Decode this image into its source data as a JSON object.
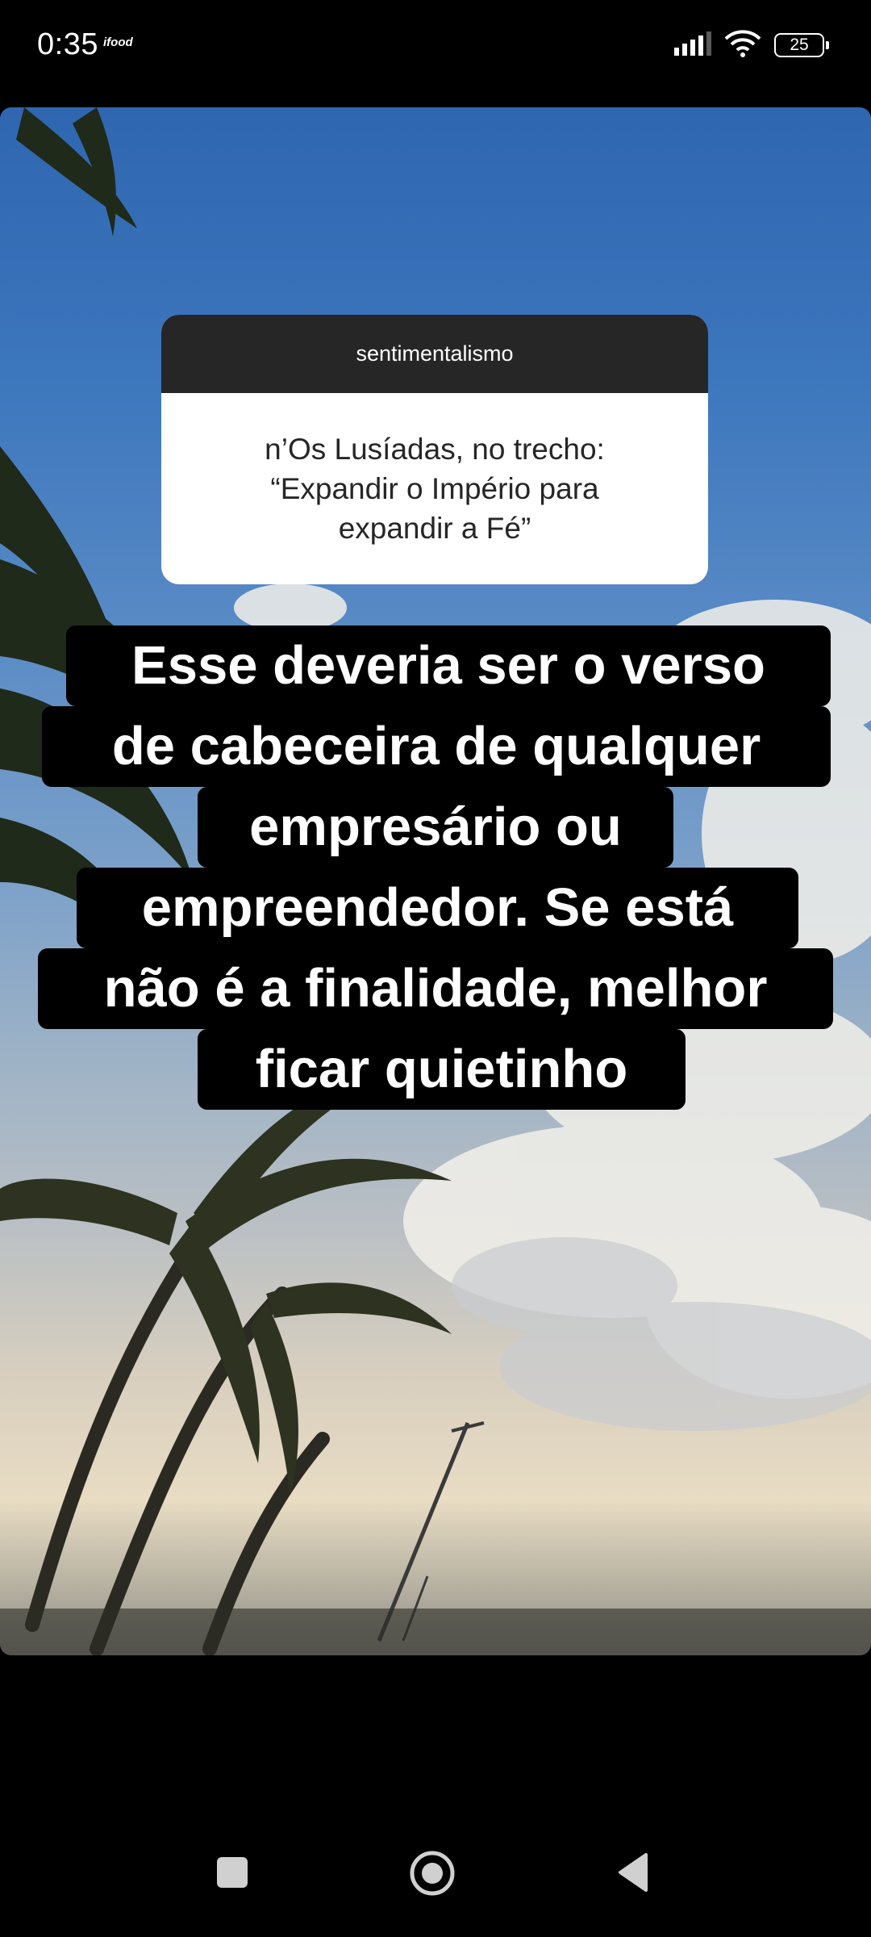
{
  "status_bar": {
    "time": "0:35",
    "app_icon_label": "ifood",
    "battery_level": "25",
    "icons": [
      "signal-icon",
      "wifi-icon",
      "battery-icon"
    ]
  },
  "question": {
    "author": "sentimentalismo",
    "lines": [
      "n’Os Lusíadas, no trecho:",
      "“Expandir o Império para",
      "expandir a Fé”"
    ]
  },
  "caption": {
    "lines": [
      "Esse deveria ser o verso",
      "de cabeceira de qualquer",
      "empresário ou",
      "empreendedor. Se está",
      "não é a finalidade, melhor",
      "ficar quietinho"
    ]
  },
  "nav": {
    "icons": [
      "recents-square-icon",
      "home-circle-icon",
      "back-triangle-icon"
    ]
  }
}
